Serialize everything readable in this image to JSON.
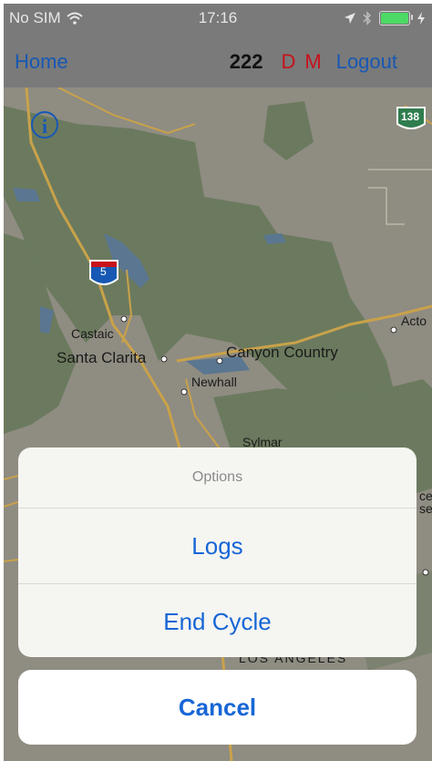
{
  "status_bar": {
    "carrier": "No SIM",
    "time": "17:16",
    "battery_level": 1.0
  },
  "nav": {
    "home_label": "Home",
    "count": "222",
    "d_label": "D",
    "m_label": "M",
    "logout_label": "Logout"
  },
  "map": {
    "labels": {
      "castaic": "Castaic",
      "santa_clarita": "Santa Clarita",
      "canyon_country": "Canyon Country",
      "newhall": "Newhall",
      "sylmar": "Sylmar",
      "acton": "Acto",
      "los_angeles": "LOS ANGELES",
      "edge_ce": "ce",
      "edge_se": "se"
    },
    "shields": {
      "interstate": "5",
      "state_route": "138"
    },
    "info_glyph": "i"
  },
  "action_sheet": {
    "title": "Options",
    "buttons": [
      "Logs",
      "End Cycle"
    ],
    "cancel_label": "Cancel"
  },
  "colors": {
    "bar_background": "#7a7a7a",
    "link_blue": "#1758b4",
    "accent_red": "#c8121b",
    "action_blue": "#1766d6"
  }
}
